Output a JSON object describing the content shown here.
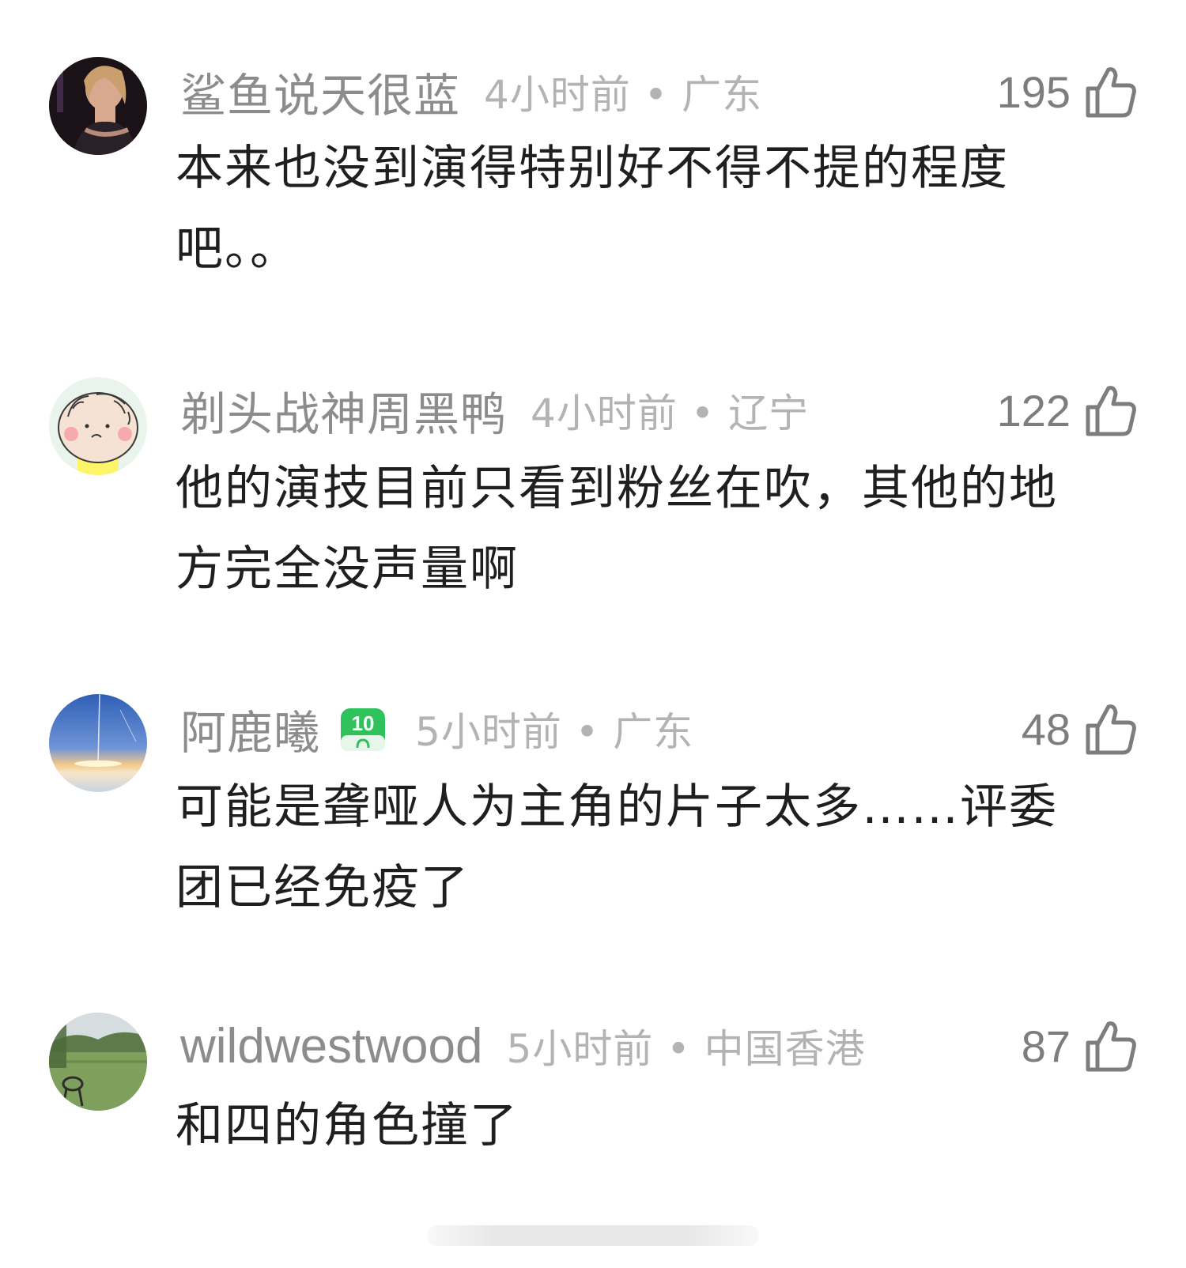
{
  "comments": [
    {
      "username": "鲨鱼说天很蓝",
      "time_location": "4小时前 • 广东",
      "likes": "195",
      "text_lines": [
        "本来也没到演得特别好不得不提的程度",
        "吧。。"
      ]
    },
    {
      "username": "剃头战神周黑鸭",
      "time_location": "4小时前 • 辽宁",
      "likes": "122",
      "text_lines": [
        "他的演技目前只看到粉丝在吹，其他的地",
        "方完全没声量啊"
      ]
    },
    {
      "username": "阿鹿曦",
      "badge_number": "10",
      "time_location": "5小时前 • 广东",
      "likes": "48",
      "text_lines": [
        "可能是聋哑人为主角的片子太多……评委",
        "团已经免疫了"
      ]
    },
    {
      "username": "wildwestwood",
      "time_location": "5小时前 • 中国香港",
      "likes": "87",
      "text_lines": [
        "和四的角色撞了"
      ]
    }
  ],
  "icons": {
    "like": "thumbs-up-icon",
    "badge": "level-badge-icon"
  },
  "colors": {
    "username": "#8c8c8c",
    "meta": "#b3b3b3",
    "text": "#1f1f1f",
    "badge_green": "#2fc25b"
  }
}
